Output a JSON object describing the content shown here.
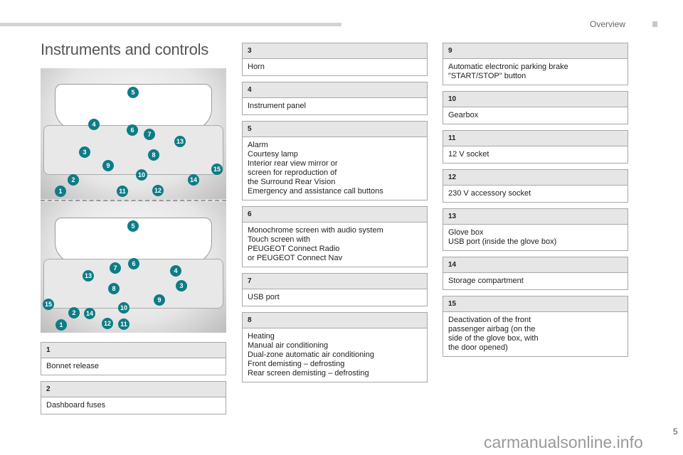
{
  "header": {
    "section": "Overview"
  },
  "title": "Instruments and controls",
  "illustration": {
    "top_callouts": [
      "5",
      "4",
      "6",
      "7",
      "13",
      "3",
      "8",
      "9",
      "10",
      "15",
      "2",
      "14",
      "1",
      "11",
      "12"
    ],
    "bottom_callouts": [
      "5",
      "6",
      "7",
      "4",
      "13",
      "3",
      "8",
      "9",
      "15",
      "10",
      "2",
      "14",
      "1",
      "12",
      "11"
    ],
    "accent": "#0e7c86"
  },
  "columns": [
    [
      {
        "num": "3",
        "lines": [
          "Horn"
        ]
      },
      {
        "num": "4",
        "lines": [
          "Instrument panel"
        ]
      },
      {
        "num": "5",
        "lines": [
          "Alarm",
          "Courtesy lamp",
          "Interior rear view mirror or",
          "screen for reproduction of",
          "the Surround Rear Vision",
          "Emergency and assistance call buttons"
        ]
      },
      {
        "num": "6",
        "lines": [
          "Monochrome screen with audio system",
          "Touch screen with",
          "PEUGEOT Connect Radio",
          "or PEUGEOT Connect Nav"
        ]
      },
      {
        "num": "7",
        "lines": [
          "USB port"
        ]
      },
      {
        "num": "8",
        "lines": [
          "Heating",
          "Manual air conditioning",
          "Dual-zone automatic air conditioning",
          "Front demisting – defrosting",
          "Rear screen demisting – defrosting"
        ]
      }
    ],
    [
      {
        "num": "9",
        "lines": [
          "Automatic electronic parking brake",
          "\"START/STOP\" button"
        ]
      },
      {
        "num": "10",
        "lines": [
          "Gearbox"
        ]
      },
      {
        "num": "11",
        "lines": [
          "12 V socket"
        ]
      },
      {
        "num": "12",
        "lines": [
          "230 V accessory socket"
        ]
      },
      {
        "num": "13",
        "lines": [
          "Glove box",
          "USB port (inside the glove box)"
        ]
      },
      {
        "num": "14",
        "lines": [
          "Storage compartment"
        ]
      },
      {
        "num": "15",
        "lines": [
          "Deactivation of the front",
          "passenger airbag (on the",
          "side of the glove box, with",
          "the door opened)"
        ]
      }
    ],
    [
      {
        "num": "1",
        "lines": [
          "Bonnet release"
        ]
      },
      {
        "num": "2",
        "lines": [
          "Dashboard fuses"
        ]
      }
    ]
  ],
  "page_number": "5",
  "watermark": "carmanualsonline.info"
}
